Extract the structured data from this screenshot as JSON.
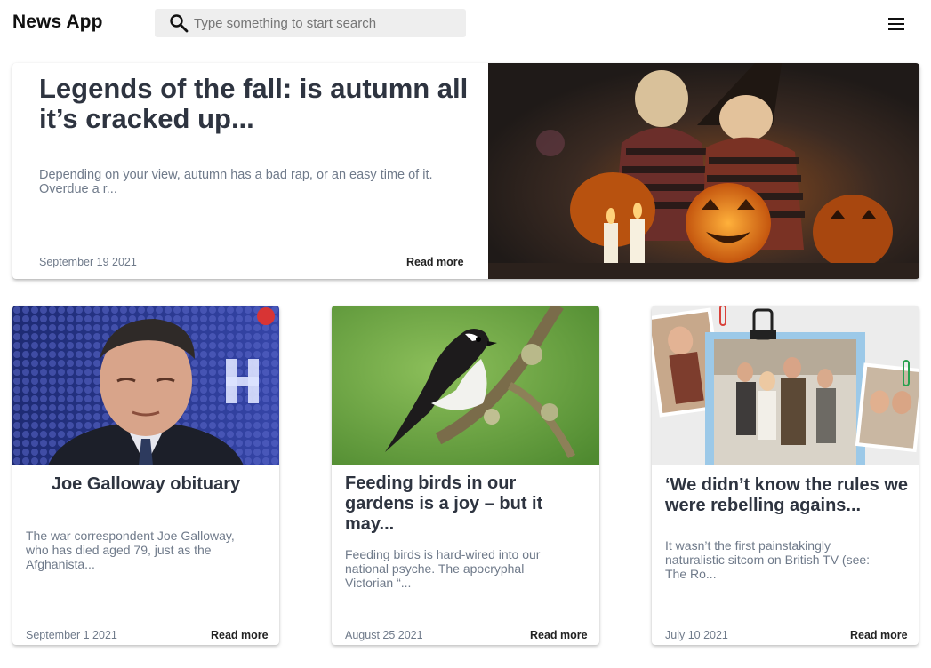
{
  "app": {
    "title": "News App"
  },
  "search": {
    "placeholder": "Type something to start search",
    "icon": "search-icon"
  },
  "menu": {
    "icon": "hamburger-menu-icon"
  },
  "hero": {
    "title": "Legends of the fall: is autumn all it’s cracked up...",
    "description": "Depending on your view, autumn has a bad rap, or an easy time of it. Overdue a r...",
    "date": "September 19 2021",
    "read_more": "Read more"
  },
  "articles": [
    {
      "title": "Joe Galloway obituary",
      "description": "The war correspondent Joe Galloway, who has died aged 79, just as the Afghanista...",
      "date": "September 1 2021",
      "read_more": "Read more"
    },
    {
      "title": "Feeding birds in our gardens is a joy – but it may...",
      "description": "Feeding birds is hard-wired into our national psyche. The apocryphal Victorian “...",
      "date": "August 25 2021",
      "read_more": "Read more"
    },
    {
      "title": "‘We didn’t know the rules we were rebelling agains...",
      "description": "It wasn’t the first painstakingly naturalistic sitcom on British TV (see: The Ro...",
      "date": "July 10 2021",
      "read_more": "Read more"
    }
  ]
}
